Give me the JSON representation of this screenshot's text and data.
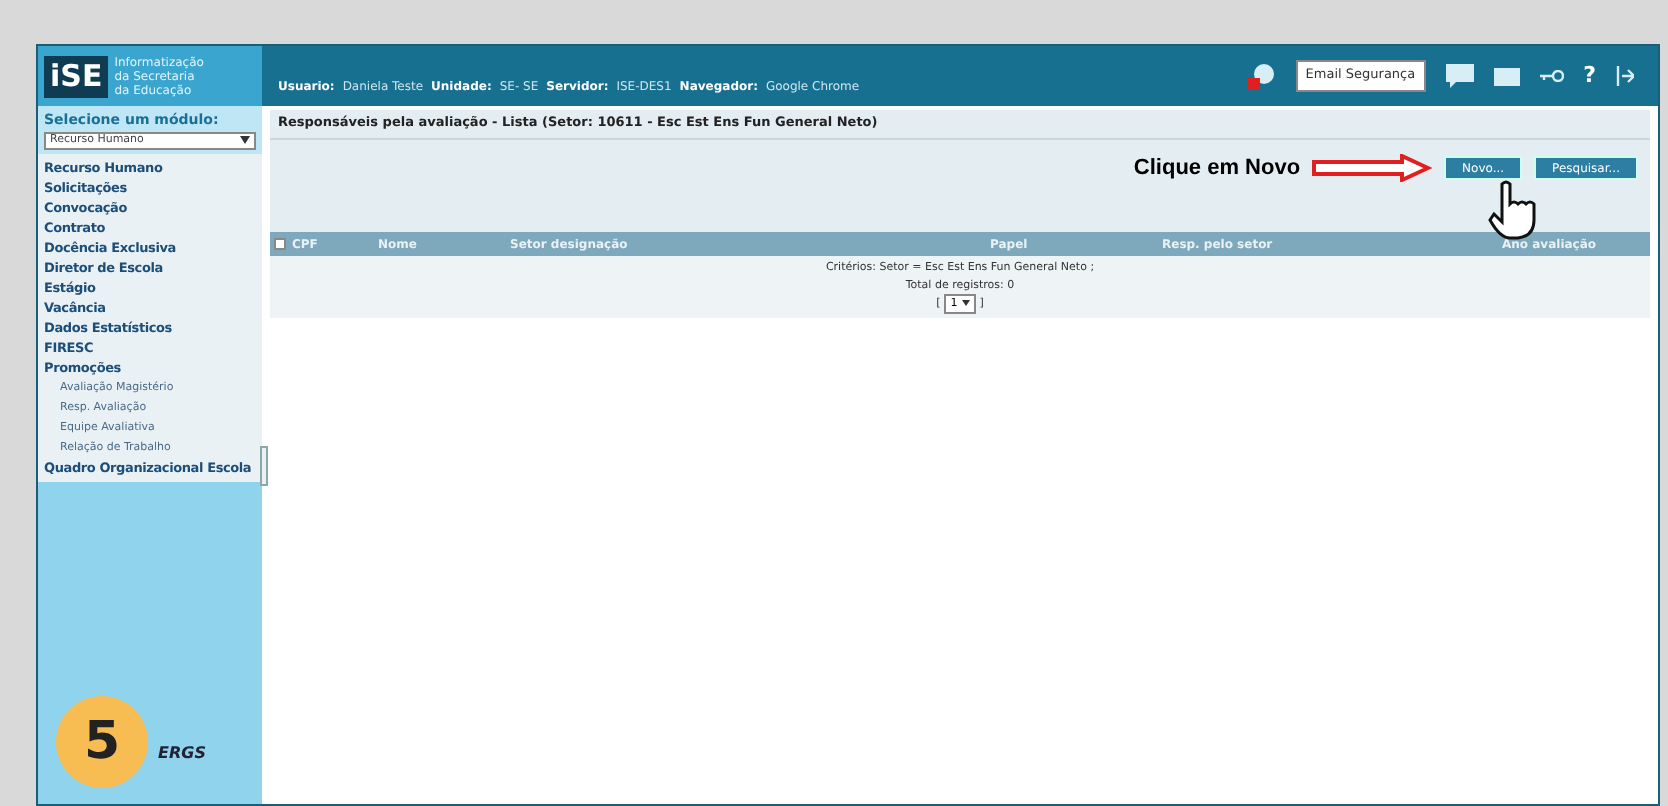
{
  "header": {
    "logo_letters": "iSE",
    "logo_text": [
      "Informatização",
      "da Secretaria",
      "da Educação"
    ],
    "info": [
      {
        "label": "Usuario:",
        "value": "Daniela Teste"
      },
      {
        "label": "Unidade:",
        "value": "SE- SE"
      },
      {
        "label": "Servidor:",
        "value": "ISE-DES1"
      },
      {
        "label": "Navegador:",
        "value": "Google Chrome"
      }
    ],
    "email_button": "Email Segurança",
    "help": "?"
  },
  "sidebar": {
    "module_label": "Selecione um módulo:",
    "module_value": "Recurso Humano",
    "items": [
      {
        "label": "Recurso Humano",
        "kind": "section"
      },
      {
        "label": "Solicitações",
        "kind": "section"
      },
      {
        "label": "Convocação",
        "kind": "section"
      },
      {
        "label": "Contrato",
        "kind": "section"
      },
      {
        "label": "Docência Exclusiva",
        "kind": "section"
      },
      {
        "label": "Diretor de Escola",
        "kind": "section"
      },
      {
        "label": "Estágio",
        "kind": "section"
      },
      {
        "label": "Vacância",
        "kind": "section"
      },
      {
        "label": "Dados Estatísticos",
        "kind": "section"
      },
      {
        "label": "FIRESC",
        "kind": "section"
      },
      {
        "label": "Promoções",
        "kind": "section"
      },
      {
        "label": "Avaliação Magistério",
        "kind": "sub"
      },
      {
        "label": "Resp. Avaliação",
        "kind": "sub"
      },
      {
        "label": "Equipe Avaliativa",
        "kind": "sub"
      },
      {
        "label": "Relação de Trabalho",
        "kind": "sub"
      },
      {
        "label": "Quadro Organizacional Escola",
        "kind": "section"
      }
    ],
    "footer_text": "ERGS"
  },
  "page": {
    "title": "Responsáveis pela avaliação - Lista (Setor: 10611 - Esc Est Ens Fun General Neto)",
    "annotation": "Clique em Novo",
    "buttons": [
      "Novo...",
      "Pesquisar..."
    ],
    "table": {
      "select_all_checked": false,
      "columns": [
        "CPF",
        "Nome",
        "Setor designação",
        "Papel",
        "Resp. pelo setor",
        "Ano avaliação"
      ],
      "criteria": "Critérios: Setor = Esc Est Ens Fun General Neto ;",
      "total": "Total de registros: 0",
      "page_open": "[",
      "page": "1",
      "page_close": "]"
    }
  },
  "step_badge": "5"
}
